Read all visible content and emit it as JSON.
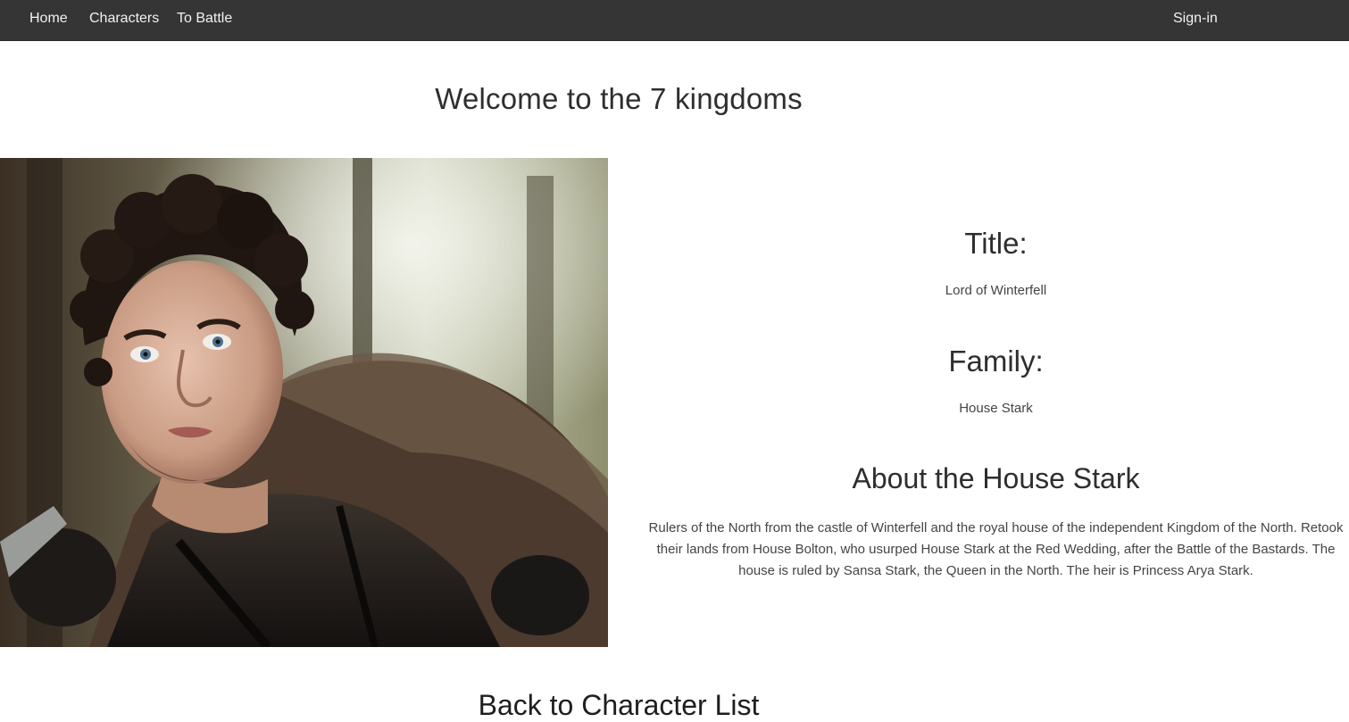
{
  "nav": {
    "home": "Home",
    "characters": "Characters",
    "battle": "To Battle",
    "signin": "Sign-in"
  },
  "page": {
    "title": "Welcome to the 7 kingdoms"
  },
  "character": {
    "title_heading": "Title:",
    "title_value": "Lord of Winterfell",
    "family_heading": "Family:",
    "family_value": "House Stark",
    "about_heading": "About the House Stark",
    "about_text": "Rulers of the North from the castle of Winterfell and the royal house of the independent Kingdom of the North. Retook their lands from House Bolton, who usurped House Stark at the Red Wedding, after the Battle of the Bastards. The house is ruled by Sansa Stark, the Queen in the North. The heir is Princess Arya Stark."
  },
  "footer": {
    "back_link": "Back to Character List"
  },
  "colors": {
    "navbar_bg": "#353535",
    "nav_text": "#f2f2f2",
    "heading_text": "#2e2e2e"
  }
}
